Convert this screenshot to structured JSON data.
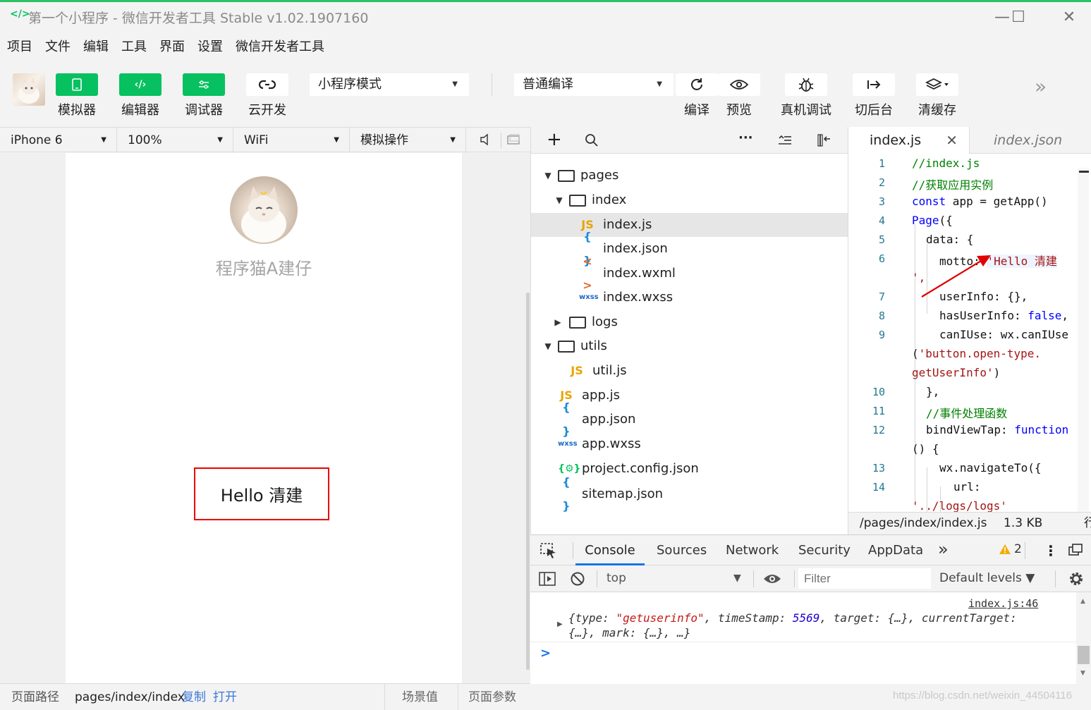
{
  "window": {
    "title": "第一个小程序 - 微信开发者工具 Stable v1.02.1907160",
    "logo_glyph": "</>"
  },
  "menu": [
    "项目",
    "文件",
    "编辑",
    "工具",
    "界面",
    "设置",
    "微信开发者工具"
  ],
  "toolbar": {
    "simulator": "模拟器",
    "editor": "编辑器",
    "debugger": "调试器",
    "cloud": "云开发",
    "mode_select": "小程序模式",
    "compile_select": "普通编译",
    "compile": "编译",
    "preview": "预览",
    "remote_debug": "真机调试",
    "background": "切后台",
    "clear_cache": "清缓存"
  },
  "simulator": {
    "device": "iPhone 6",
    "zoom": "100%",
    "network": "WiFi",
    "operation": "模拟操作",
    "user_name": "程序猫A建仔",
    "motto": "Hello 清建"
  },
  "footer": {
    "path_label": "页面路径",
    "path": "pages/index/index",
    "copy": "复制",
    "open": "打开",
    "scene": "场景值",
    "params": "页面参数"
  },
  "tree": [
    {
      "label": "pages",
      "type": "folder",
      "open": true
    },
    {
      "label": "index",
      "type": "folder",
      "open": true
    },
    {
      "label": "index.js",
      "type": "js",
      "glyph": "JS"
    },
    {
      "label": "index.json",
      "type": "json",
      "glyph": "{ }"
    },
    {
      "label": "index.wxml",
      "type": "wxml",
      "glyph": "< >"
    },
    {
      "label": "index.wxss",
      "type": "wxss",
      "glyph": "wxss"
    },
    {
      "label": "logs",
      "type": "folder",
      "open": false
    },
    {
      "label": "utils",
      "type": "folder",
      "open": true
    },
    {
      "label": "util.js",
      "type": "js",
      "glyph": "JS"
    },
    {
      "label": "app.js",
      "type": "js",
      "glyph": "JS"
    },
    {
      "label": "app.json",
      "type": "json",
      "glyph": "{ }"
    },
    {
      "label": "app.wxss",
      "type": "wxss",
      "glyph": "wxss"
    },
    {
      "label": "project.config.json",
      "type": "cfg",
      "glyph": "{⚙}"
    },
    {
      "label": "sitemap.json",
      "type": "json",
      "glyph": "{ }"
    }
  ],
  "editor": {
    "tab_active": "index.js",
    "tab_other": "index.json",
    "status_path": "/pages/index/index.js",
    "status_size": "1.3 KB",
    "status_extra": "行",
    "line_numbers": [
      "1",
      "2",
      "3",
      "4",
      "5",
      "6",
      "7",
      "8",
      "9",
      "10",
      "11",
      "12",
      "13",
      "14"
    ],
    "code": {
      "l1": "//index.js",
      "l2": "//获取应用实例",
      "l3_kw": "const",
      "l3_rest": " app = getApp()",
      "l4_fn": "Page",
      "l4_rest": "({",
      "l5": "data: {",
      "l6_key": "motto: ",
      "l6_str": "'Hello 清建",
      "l6b": "',",
      "l7": "userInfo: {},",
      "l8_key": "hasUserInfo: ",
      "l8_val": "false",
      "l8_end": ",",
      "l9": "canIUse: wx.canIUse",
      "l9b_open": "(",
      "l9b_str": "'button.open-type.",
      "l9c_str": "getUserInfo'",
      "l9c_close": ")",
      "l10": "},",
      "l11": "//事件处理函数",
      "l12_key": "bindViewTap: ",
      "l12_kw": "function",
      "l12b": "() {",
      "l13": "wx.navigateTo({",
      "l14": "url:",
      "l14b": "'../logs/logs'"
    }
  },
  "devtools": {
    "tabs": [
      "Console",
      "Sources",
      "Network",
      "Security",
      "AppData"
    ],
    "more": "»",
    "warnings": "2",
    "context": "top",
    "filter_placeholder": "Filter",
    "levels": "Default levels ▼",
    "log_source": "index.js:46",
    "log_line1": {
      "p1": "{type: ",
      "s1": "\"getuserinfo\"",
      "p2": ", timeStamp: ",
      "n1": "5569",
      "p3": ", target: {…}, currentTarget:"
    },
    "log_line2": "{…}, mark: {…}, …}",
    "prompt": ">"
  },
  "watermark": "https://blog.csdn.net/weixin_44504116",
  "colors": {
    "brand_green": "#07c160",
    "annotation_red": "#e00000",
    "tab_active_blue": "#1a73e8"
  }
}
